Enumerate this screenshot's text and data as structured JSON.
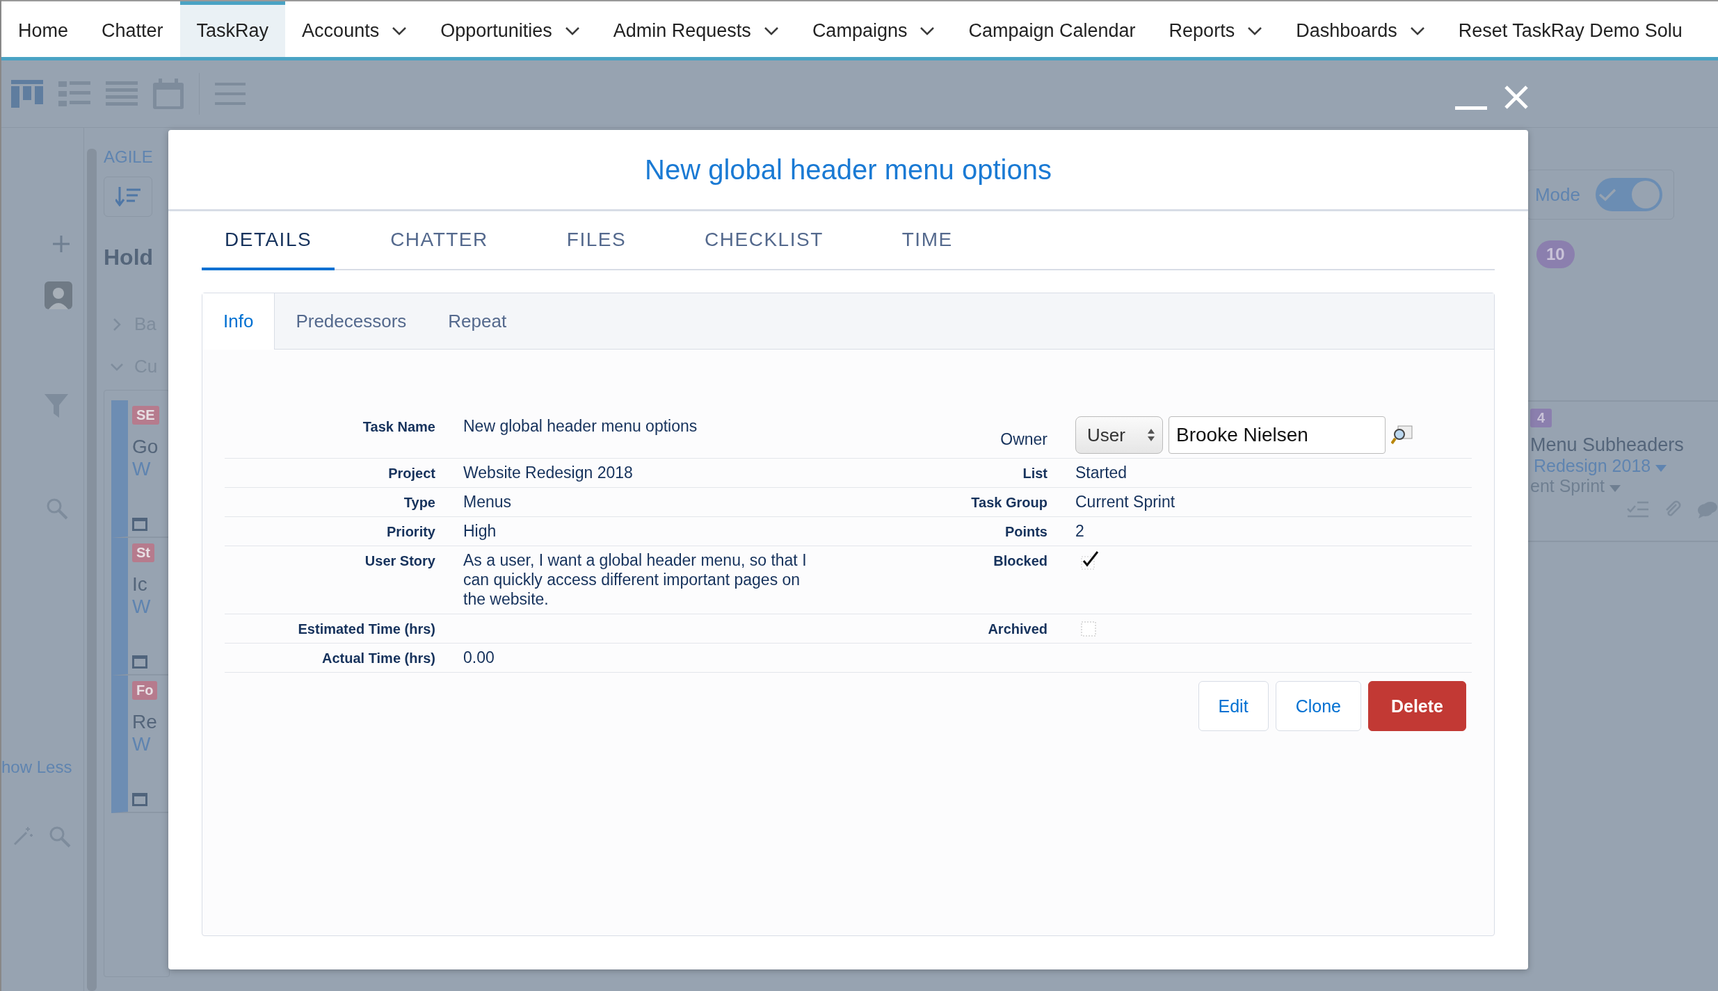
{
  "nav": {
    "items": [
      {
        "label": "Home",
        "dropdown": false,
        "selected": false
      },
      {
        "label": "Chatter",
        "dropdown": false,
        "selected": false
      },
      {
        "label": "TaskRay",
        "dropdown": false,
        "selected": true
      },
      {
        "label": "Accounts",
        "dropdown": true,
        "selected": false
      },
      {
        "label": "Opportunities",
        "dropdown": true,
        "selected": false
      },
      {
        "label": "Admin Requests",
        "dropdown": true,
        "selected": false
      },
      {
        "label": "Campaigns",
        "dropdown": true,
        "selected": false
      },
      {
        "label": "Campaign Calendar",
        "dropdown": false,
        "selected": false
      },
      {
        "label": "Reports",
        "dropdown": true,
        "selected": false
      },
      {
        "label": "Dashboards",
        "dropdown": true,
        "selected": false
      },
      {
        "label": "Reset TaskRay Demo Solu",
        "dropdown": false,
        "selected": false
      }
    ]
  },
  "background": {
    "board_label": "AGILE",
    "column_title": "Hold",
    "groups": [
      {
        "label": "Ba",
        "expanded": false
      },
      {
        "label": "Cu",
        "expanded": true
      }
    ],
    "cards": [
      {
        "tag": "SE",
        "title": "Go",
        "project": "W"
      },
      {
        "tag": "St",
        "title": "Ic",
        "project": "W"
      },
      {
        "tag": "Fo",
        "title": "Re",
        "project": "W"
      }
    ],
    "show_less": "how Less",
    "mode_label": "Mode",
    "mode_toggle": {
      "on": true
    },
    "count": "10",
    "right_card": {
      "tag": "4",
      "title": "Menu Subheaders",
      "project": "Redesign 2018",
      "task_group": "ent Sprint"
    }
  },
  "modal": {
    "title": "New global header menu options",
    "tabs": [
      {
        "label": "DETAILS",
        "selected": true
      },
      {
        "label": "CHATTER",
        "selected": false
      },
      {
        "label": "FILES",
        "selected": false
      },
      {
        "label": "CHECKLIST",
        "selected": false
      },
      {
        "label": "TIME",
        "selected": false
      }
    ],
    "subtabs": [
      {
        "label": "Info",
        "selected": true
      },
      {
        "label": "Predecessors",
        "selected": false
      },
      {
        "label": "Repeat",
        "selected": false
      }
    ],
    "rows": [
      {
        "left": {
          "label": "Task Name",
          "value": "New global header menu options"
        },
        "right": {
          "kind": "owner",
          "label": "Owner",
          "type": "User",
          "value": "Brooke Nielsen"
        }
      },
      {
        "left": {
          "label": "Project",
          "value": "Website Redesign 2018"
        },
        "right": {
          "kind": "text",
          "label": "List",
          "value": "Started"
        }
      },
      {
        "left": {
          "label": "Type",
          "value": "Menus"
        },
        "right": {
          "kind": "text",
          "label": "Task Group",
          "value": "Current Sprint"
        }
      },
      {
        "left": {
          "label": "Priority",
          "value": "High"
        },
        "right": {
          "kind": "text",
          "label": "Points",
          "value": "2"
        }
      },
      {
        "left": {
          "label": "User Story",
          "value": "As a user, I want a global header menu, so that I can quickly access different important pages on the website."
        },
        "right": {
          "kind": "checkbox",
          "label": "Blocked",
          "checked": true
        }
      },
      {
        "left": {
          "label": "Estimated Time (hrs)"
        },
        "right": {
          "kind": "checkbox",
          "label": "Archived",
          "checked": false
        }
      },
      {
        "left": {
          "label": "Actual Time (hrs)",
          "value": "0.00"
        },
        "right": {
          "kind": "none"
        }
      }
    ],
    "buttons": [
      {
        "label": "Edit",
        "kind": "neutral"
      },
      {
        "label": "Clone",
        "kind": "neutral"
      },
      {
        "label": "Delete",
        "kind": "danger"
      }
    ]
  }
}
